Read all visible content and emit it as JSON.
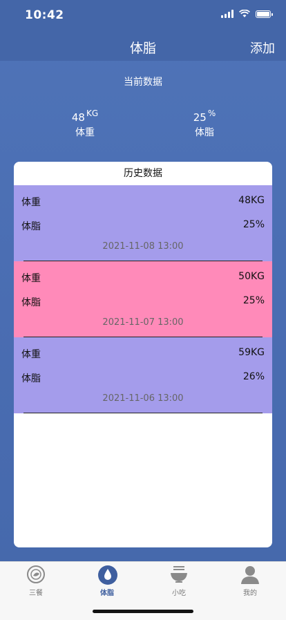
{
  "status": {
    "time": "10:42"
  },
  "nav": {
    "title": "体脂",
    "add_label": "添加"
  },
  "current": {
    "label": "当前数据",
    "weight": {
      "value": "48",
      "unit": "KG",
      "name": "体重"
    },
    "fat": {
      "value": "25",
      "unit": "%",
      "name": "体脂"
    }
  },
  "history": {
    "title": "历史数据",
    "records": [
      {
        "weight_label": "体重",
        "weight": "48KG",
        "fat_label": "体脂",
        "fat": "25%",
        "date": "2021-11-08 13:00",
        "bg": "#a49ceb"
      },
      {
        "weight_label": "体重",
        "weight": "50KG",
        "fat_label": "体脂",
        "fat": "25%",
        "date": "2021-11-07 13:00",
        "bg": "#ff8ab9"
      },
      {
        "weight_label": "体重",
        "weight": "59KG",
        "fat_label": "体脂",
        "fat": "26%",
        "date": "2021-11-06 13:00",
        "bg": "#a49ceb"
      }
    ]
  },
  "tabs": [
    {
      "label": "三餐",
      "icon": "meal-plate-icon"
    },
    {
      "label": "体脂",
      "icon": "water-drop-icon",
      "active": true
    },
    {
      "label": "小吃",
      "icon": "noodle-bowl-icon"
    },
    {
      "label": "我的",
      "icon": "person-icon"
    }
  ],
  "colors": {
    "accent": "#3f5f9f",
    "background": "#4a6db2"
  }
}
